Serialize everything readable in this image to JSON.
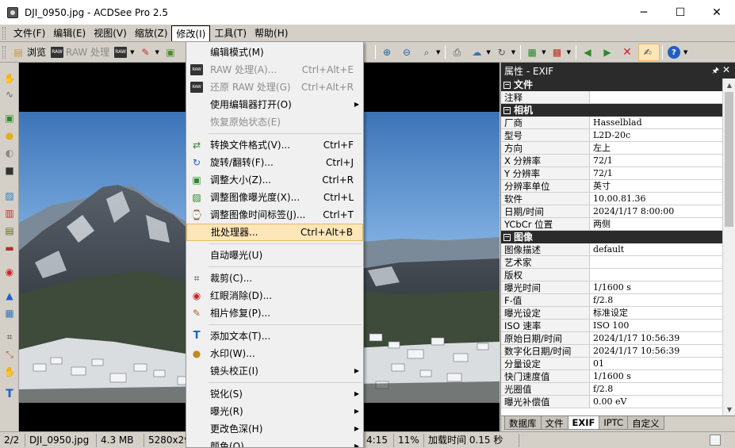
{
  "window": {
    "title": "DJI_0950.jpg - ACDSee Pro 2.5",
    "minimize": "─",
    "maximize": "☐",
    "close": "✕"
  },
  "menubar": {
    "items": [
      "文件(F)",
      "编辑(E)",
      "视图(V)",
      "缩放(Z)",
      "修改(I)",
      "工具(T)",
      "帮助(H)"
    ]
  },
  "toolbar": {
    "browse": "浏览",
    "raw_process": "RAW 处理",
    "raw_icon": "RAW"
  },
  "edit_menu": {
    "items": [
      {
        "label": "编辑模式(M)",
        "shortcut": "",
        "icon": "",
        "disabled": false
      },
      {
        "label": "RAW 处理(A)...",
        "shortcut": "Ctrl+Alt+E",
        "icon": "raw-icon",
        "disabled": true
      },
      {
        "label": "还原 RAW 处理(G)",
        "shortcut": "Ctrl+Alt+R",
        "icon": "raw-icon",
        "disabled": true
      },
      {
        "label": "使用编辑器打开(O)",
        "shortcut": "",
        "icon": "",
        "disabled": false,
        "submenu": true
      },
      {
        "label": "恢复原始状态(E)",
        "shortcut": "",
        "icon": "",
        "disabled": true
      },
      {
        "label": "转换文件格式(V)...",
        "shortcut": "Ctrl+F",
        "icon": "convert-icon",
        "disabled": false
      },
      {
        "label": "旋转/翻转(F)...",
        "shortcut": "Ctrl+J",
        "icon": "rotate-icon",
        "disabled": false
      },
      {
        "label": "调整大小(Z)...",
        "shortcut": "Ctrl+R",
        "icon": "resize-icon",
        "disabled": false
      },
      {
        "label": "调整图像曝光度(X)...",
        "shortcut": "Ctrl+L",
        "icon": "exposure-icon",
        "disabled": false
      },
      {
        "label": "调整图像时间标签(J)...",
        "shortcut": "Ctrl+T",
        "icon": "timestamp-icon",
        "disabled": false
      },
      {
        "label": "批处理器...",
        "shortcut": "Ctrl+Alt+B",
        "icon": "",
        "disabled": false,
        "highlighted": true
      },
      {
        "label": "自动曝光(U)",
        "shortcut": "",
        "icon": "",
        "disabled": false
      },
      {
        "label": "裁剪(C)...",
        "shortcut": "",
        "icon": "crop-icon",
        "disabled": false
      },
      {
        "label": "红眼消除(D)...",
        "shortcut": "",
        "icon": "red-eye-icon",
        "disabled": false
      },
      {
        "label": "相片修复(P)...",
        "shortcut": "",
        "icon": "repair-icon",
        "disabled": false
      },
      {
        "label": "添加文本(T)...",
        "shortcut": "",
        "icon": "text-icon",
        "disabled": false
      },
      {
        "label": "水印(W)...",
        "shortcut": "",
        "icon": "watermark-icon",
        "disabled": false
      },
      {
        "label": "镜头校正(I)",
        "shortcut": "",
        "icon": "",
        "disabled": false,
        "submenu": true
      },
      {
        "label": "锐化(S)",
        "shortcut": "",
        "icon": "",
        "disabled": false,
        "submenu": true
      },
      {
        "label": "曝光(R)",
        "shortcut": "",
        "icon": "",
        "disabled": false,
        "submenu": true
      },
      {
        "label": "更改色深(H)",
        "shortcut": "",
        "icon": "",
        "disabled": false,
        "submenu": true
      },
      {
        "label": "颜色(O)",
        "shortcut": "",
        "icon": "",
        "disabled": false,
        "submenu": true
      }
    ]
  },
  "properties": {
    "title": "属性 - EXIF",
    "pin": "🖈",
    "close": "✕",
    "groups": [
      {
        "name": "文件",
        "rows": [
          {
            "k": "注释",
            "v": ""
          }
        ]
      },
      {
        "name": "相机",
        "rows": [
          {
            "k": "厂商",
            "v": "Hasselblad"
          },
          {
            "k": "型号",
            "v": "L2D-20c"
          },
          {
            "k": "方向",
            "v": "左上"
          },
          {
            "k": "X 分辨率",
            "v": "72/1"
          },
          {
            "k": "Y 分辨率",
            "v": "72/1"
          },
          {
            "k": "分辨率单位",
            "v": "英寸"
          },
          {
            "k": "软件",
            "v": "10.00.81.36"
          },
          {
            "k": "日期/时间",
            "v": "2024/1/17 8:00:00"
          },
          {
            "k": "YCbCr 位置",
            "v": "两侧"
          }
        ]
      },
      {
        "name": "图像",
        "rows": [
          {
            "k": "图像描述",
            "v": "default"
          },
          {
            "k": "艺术家",
            "v": ""
          },
          {
            "k": "版权",
            "v": ""
          },
          {
            "k": "曝光时间",
            "v": "1/1600 s"
          },
          {
            "k": "F-值",
            "v": "f/2.8"
          },
          {
            "k": "曝光设定",
            "v": "标准设定"
          },
          {
            "k": "ISO 速率",
            "v": "ISO 100"
          },
          {
            "k": "原始日期/时间",
            "v": "2024/1/17 10:56:39"
          },
          {
            "k": "数字化日期/时间",
            "v": "2024/1/17 10:56:39"
          },
          {
            "k": "分量设定",
            "v": "01"
          },
          {
            "k": "快门速度值",
            "v": "1/1600 s"
          },
          {
            "k": "光圈值",
            "v": "f/2.8"
          },
          {
            "k": "曝光补偿值",
            "v": "0.00 eV"
          }
        ]
      }
    ],
    "tabs": [
      "数据库",
      "文件",
      "EXIF",
      "IPTC",
      "自定义"
    ],
    "active_tab": "EXIF"
  },
  "status": {
    "index": "2/2",
    "filename": "DJI_0950.jpg",
    "size": "4.3 MB",
    "dimensions": "5280x29",
    "time": "4:15",
    "zoom": "11%",
    "load_time": "加载时间 0.15 秒"
  }
}
